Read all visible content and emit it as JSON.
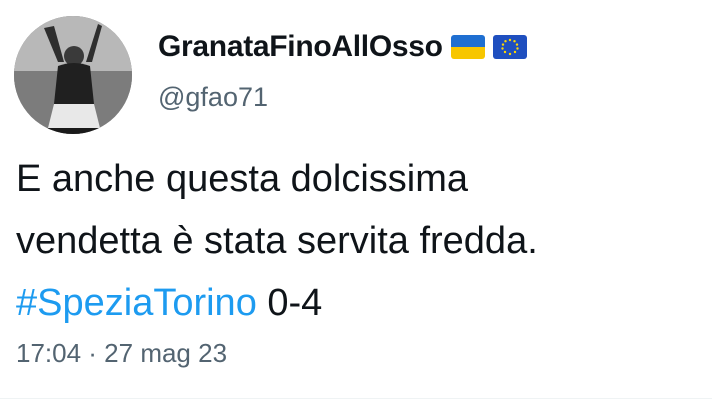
{
  "author": {
    "display_name": "GranataFinoAllOsso",
    "handle": "@gfao71",
    "avatar_icon": "celebrating-player-avatar",
    "badges": [
      "ukraine-flag-icon",
      "eu-flag-icon"
    ]
  },
  "tweet": {
    "line1": "E anche questa dolcissima",
    "line2": "vendetta è stata servita fredda.",
    "hashtag": "#SpeziaTorino",
    "score": "0-4"
  },
  "meta": {
    "timestamp": "17:04 · 27 mag 23"
  },
  "colors": {
    "text": "#0f1419",
    "secondary": "#536471",
    "hashtag": "#1d9bf0"
  }
}
